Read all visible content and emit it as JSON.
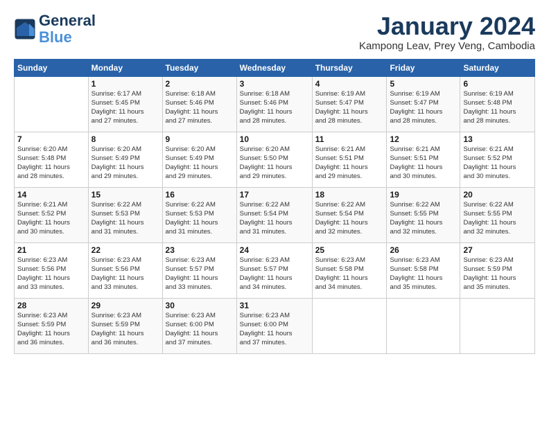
{
  "logo": {
    "line1": "General",
    "line2": "Blue"
  },
  "title": "January 2024",
  "subtitle": "Kampong Leav, Prey Veng, Cambodia",
  "header_days": [
    "Sunday",
    "Monday",
    "Tuesday",
    "Wednesday",
    "Thursday",
    "Friday",
    "Saturday"
  ],
  "weeks": [
    [
      {
        "num": "",
        "info": ""
      },
      {
        "num": "1",
        "info": "Sunrise: 6:17 AM\nSunset: 5:45 PM\nDaylight: 11 hours\nand 27 minutes."
      },
      {
        "num": "2",
        "info": "Sunrise: 6:18 AM\nSunset: 5:46 PM\nDaylight: 11 hours\nand 27 minutes."
      },
      {
        "num": "3",
        "info": "Sunrise: 6:18 AM\nSunset: 5:46 PM\nDaylight: 11 hours\nand 28 minutes."
      },
      {
        "num": "4",
        "info": "Sunrise: 6:19 AM\nSunset: 5:47 PM\nDaylight: 11 hours\nand 28 minutes."
      },
      {
        "num": "5",
        "info": "Sunrise: 6:19 AM\nSunset: 5:47 PM\nDaylight: 11 hours\nand 28 minutes."
      },
      {
        "num": "6",
        "info": "Sunrise: 6:19 AM\nSunset: 5:48 PM\nDaylight: 11 hours\nand 28 minutes."
      }
    ],
    [
      {
        "num": "7",
        "info": "Sunrise: 6:20 AM\nSunset: 5:48 PM\nDaylight: 11 hours\nand 28 minutes."
      },
      {
        "num": "8",
        "info": "Sunrise: 6:20 AM\nSunset: 5:49 PM\nDaylight: 11 hours\nand 29 minutes."
      },
      {
        "num": "9",
        "info": "Sunrise: 6:20 AM\nSunset: 5:49 PM\nDaylight: 11 hours\nand 29 minutes."
      },
      {
        "num": "10",
        "info": "Sunrise: 6:20 AM\nSunset: 5:50 PM\nDaylight: 11 hours\nand 29 minutes."
      },
      {
        "num": "11",
        "info": "Sunrise: 6:21 AM\nSunset: 5:51 PM\nDaylight: 11 hours\nand 29 minutes."
      },
      {
        "num": "12",
        "info": "Sunrise: 6:21 AM\nSunset: 5:51 PM\nDaylight: 11 hours\nand 30 minutes."
      },
      {
        "num": "13",
        "info": "Sunrise: 6:21 AM\nSunset: 5:52 PM\nDaylight: 11 hours\nand 30 minutes."
      }
    ],
    [
      {
        "num": "14",
        "info": "Sunrise: 6:21 AM\nSunset: 5:52 PM\nDaylight: 11 hours\nand 30 minutes."
      },
      {
        "num": "15",
        "info": "Sunrise: 6:22 AM\nSunset: 5:53 PM\nDaylight: 11 hours\nand 31 minutes."
      },
      {
        "num": "16",
        "info": "Sunrise: 6:22 AM\nSunset: 5:53 PM\nDaylight: 11 hours\nand 31 minutes."
      },
      {
        "num": "17",
        "info": "Sunrise: 6:22 AM\nSunset: 5:54 PM\nDaylight: 11 hours\nand 31 minutes."
      },
      {
        "num": "18",
        "info": "Sunrise: 6:22 AM\nSunset: 5:54 PM\nDaylight: 11 hours\nand 32 minutes."
      },
      {
        "num": "19",
        "info": "Sunrise: 6:22 AM\nSunset: 5:55 PM\nDaylight: 11 hours\nand 32 minutes."
      },
      {
        "num": "20",
        "info": "Sunrise: 6:22 AM\nSunset: 5:55 PM\nDaylight: 11 hours\nand 32 minutes."
      }
    ],
    [
      {
        "num": "21",
        "info": "Sunrise: 6:23 AM\nSunset: 5:56 PM\nDaylight: 11 hours\nand 33 minutes."
      },
      {
        "num": "22",
        "info": "Sunrise: 6:23 AM\nSunset: 5:56 PM\nDaylight: 11 hours\nand 33 minutes."
      },
      {
        "num": "23",
        "info": "Sunrise: 6:23 AM\nSunset: 5:57 PM\nDaylight: 11 hours\nand 33 minutes."
      },
      {
        "num": "24",
        "info": "Sunrise: 6:23 AM\nSunset: 5:57 PM\nDaylight: 11 hours\nand 34 minutes."
      },
      {
        "num": "25",
        "info": "Sunrise: 6:23 AM\nSunset: 5:58 PM\nDaylight: 11 hours\nand 34 minutes."
      },
      {
        "num": "26",
        "info": "Sunrise: 6:23 AM\nSunset: 5:58 PM\nDaylight: 11 hours\nand 35 minutes."
      },
      {
        "num": "27",
        "info": "Sunrise: 6:23 AM\nSunset: 5:59 PM\nDaylight: 11 hours\nand 35 minutes."
      }
    ],
    [
      {
        "num": "28",
        "info": "Sunrise: 6:23 AM\nSunset: 5:59 PM\nDaylight: 11 hours\nand 36 minutes."
      },
      {
        "num": "29",
        "info": "Sunrise: 6:23 AM\nSunset: 5:59 PM\nDaylight: 11 hours\nand 36 minutes."
      },
      {
        "num": "30",
        "info": "Sunrise: 6:23 AM\nSunset: 6:00 PM\nDaylight: 11 hours\nand 37 minutes."
      },
      {
        "num": "31",
        "info": "Sunrise: 6:23 AM\nSunset: 6:00 PM\nDaylight: 11 hours\nand 37 minutes."
      },
      {
        "num": "",
        "info": ""
      },
      {
        "num": "",
        "info": ""
      },
      {
        "num": "",
        "info": ""
      }
    ]
  ]
}
